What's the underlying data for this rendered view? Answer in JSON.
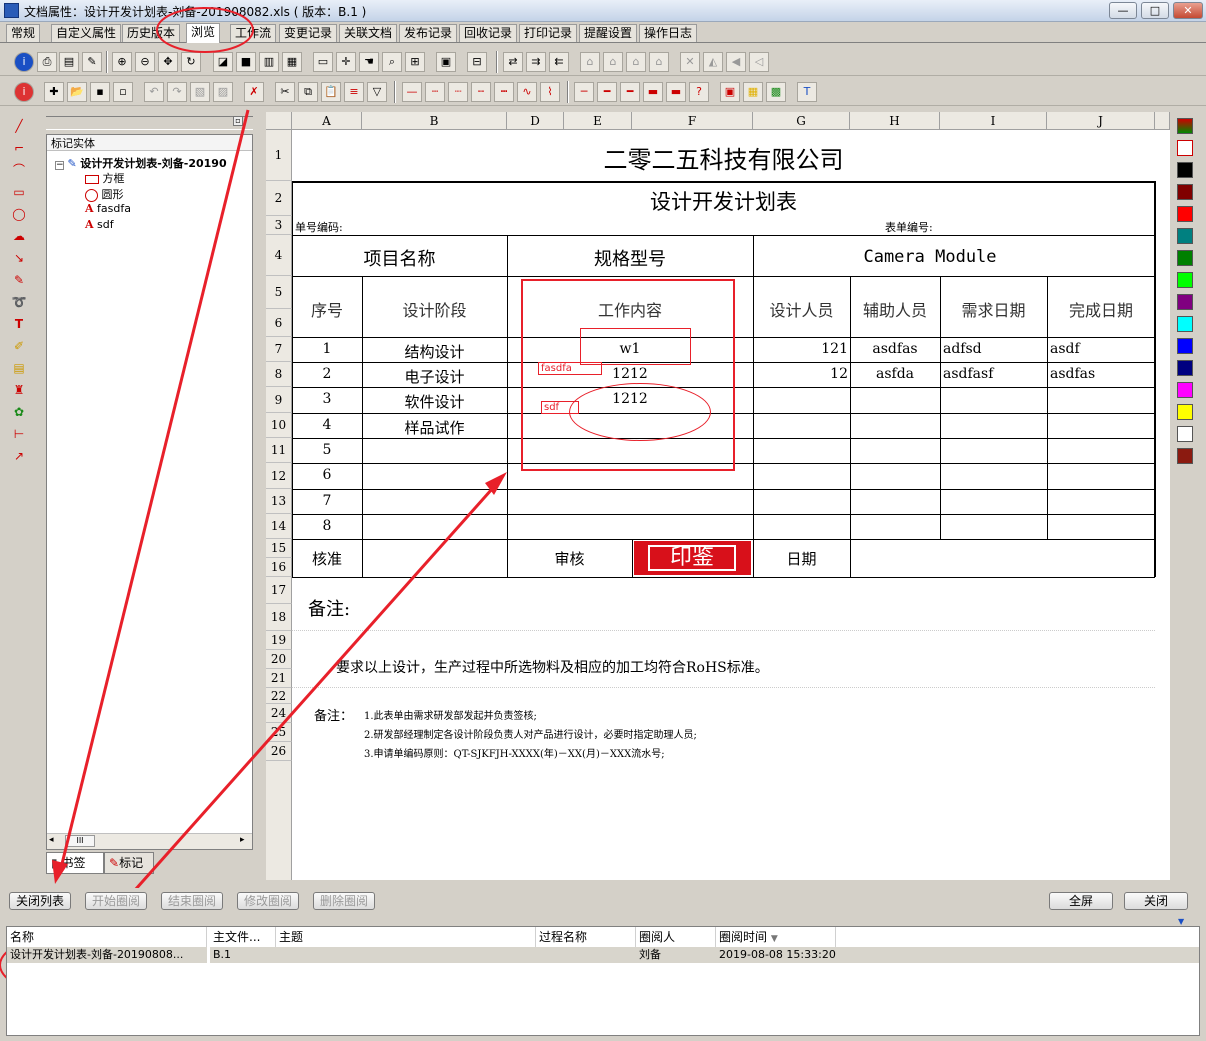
{
  "window": {
    "title": "文档属性：设计开发计划表-刘备-201908082.xls ( 版本：B.1 )",
    "min": "—",
    "max": "□",
    "close": "✕"
  },
  "tabs": [
    "常规",
    "自定义属性",
    "历史版本",
    "浏览",
    "工作流",
    "变更记录",
    "关联文档",
    "发布记录",
    "回收记录",
    "打印记录",
    "提醒设置",
    "操作日志"
  ],
  "tree": {
    "header": "标记实体",
    "root": "设计开发计划表-刘备-20190",
    "items": [
      "方框",
      "圆形",
      "fasdfa",
      "sdf"
    ],
    "scroll_label": "III",
    "tab_bookmark": "书签",
    "tab_mark": "标记"
  },
  "columns": [
    "A",
    "B",
    "D",
    "E",
    "F",
    "G",
    "H",
    "I",
    "J"
  ],
  "rows": [
    "1",
    "2",
    "3",
    "4",
    "5",
    "6",
    "7",
    "8",
    "9",
    "10",
    "11",
    "12",
    "13",
    "14",
    "15",
    "16",
    "17",
    "18",
    "19",
    "20",
    "21",
    "22",
    "24",
    "25",
    "26"
  ],
  "sheet": {
    "company": "二零二五科技有限公司",
    "form_title": "设计开发计划表",
    "doc_no_label": "单号编码:",
    "form_no_label": "表单编号:",
    "project_name_label": "项目名称",
    "spec_label": "规格型号",
    "project_value": "Camera Module",
    "h_seq": "序号",
    "h_stage": "设计阶段",
    "h_work": "工作内容",
    "h_designer": "设计人员",
    "h_assist": "辅助人员",
    "h_req_date": "需求日期",
    "h_done_date": "完成日期",
    "data_rows": [
      {
        "seq": "1",
        "stage": "结构设计",
        "work": "w1",
        "designer": "121",
        "assist": "asdfas",
        "req": "adfsd",
        "done": "asdf"
      },
      {
        "seq": "2",
        "stage": "电子设计",
        "work": "1212",
        "designer": "12",
        "assist": "asfda",
        "req": "asdfasf",
        "done": "asdfas"
      },
      {
        "seq": "3",
        "stage": "软件设计",
        "work": "1212",
        "designer": "",
        "assist": "",
        "req": "",
        "done": ""
      },
      {
        "seq": "4",
        "stage": "样品试作",
        "work": "",
        "designer": "",
        "assist": "",
        "req": "",
        "done": ""
      },
      {
        "seq": "5",
        "stage": "",
        "work": "",
        "designer": "",
        "assist": "",
        "req": "",
        "done": ""
      },
      {
        "seq": "6",
        "stage": "",
        "work": "",
        "designer": "",
        "assist": "",
        "req": "",
        "done": ""
      },
      {
        "seq": "7",
        "stage": "",
        "work": "",
        "designer": "",
        "assist": "",
        "req": "",
        "done": ""
      },
      {
        "seq": "8",
        "stage": "",
        "work": "",
        "designer": "",
        "assist": "",
        "req": "",
        "done": ""
      }
    ],
    "approve": "核准",
    "review": "审核",
    "stamp": "印鉴",
    "date": "日期",
    "remark_title": "备注:",
    "requirement": "要求以上设计，生产过程中所选物料及相应的加工均符合RoHS标准。",
    "notes_label": "备注：",
    "notes": [
      "1.此表单由需求研发部发起并负责签核;",
      "2.研发部经理制定各设计阶段负责人对产品进行设计，必要时指定助理人员;",
      "3.申请单编码原则：QT-SJKFJH-XXXX(年)－XX(月)－XXX流水号;"
    ],
    "annot_fasdfa": "fasdfa",
    "annot_sdf": "sdf"
  },
  "bottom_buttons": {
    "close_list": "关闭列表",
    "start": "开始圈阅",
    "end": "结束圈阅",
    "modify": "修改圈阅",
    "delete": "删除圈阅",
    "fullscreen": "全屏",
    "close": "关闭"
  },
  "list": {
    "headers": [
      "名称",
      "主文件...",
      "主题",
      "过程名称",
      "圈阅人",
      "圈阅时间"
    ],
    "row": {
      "name": "设计开发计划表-刘备-20190808...",
      "main": "B.1",
      "topic": "",
      "process": "",
      "reviewer": "刘备",
      "time": "2019-08-08 15:33:20"
    }
  },
  "colors": {
    "annotation": "#e8202a",
    "stamp": "#d8101a"
  }
}
